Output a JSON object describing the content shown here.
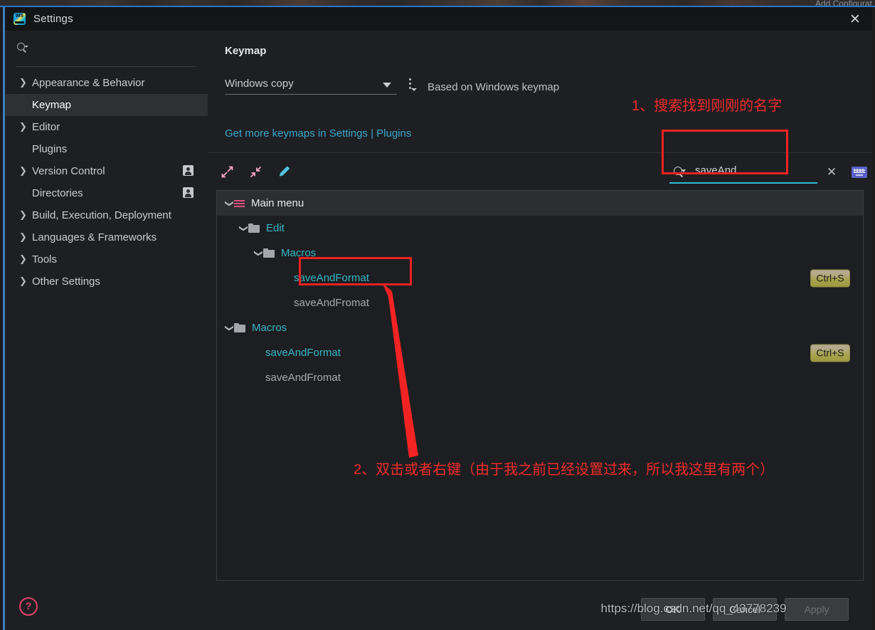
{
  "background": {
    "add_configuration_label": "Add Configurat"
  },
  "window": {
    "title": "Settings",
    "app_icon": "webstorm-icon",
    "close_icon": "close-icon"
  },
  "sidebar": {
    "search": {
      "placeholder": "",
      "value": "",
      "icon": "search-icon"
    },
    "items": [
      {
        "label": "Appearance & Behavior",
        "expandable": true,
        "selected": false,
        "badge": false
      },
      {
        "label": "Keymap",
        "expandable": false,
        "selected": true,
        "badge": false
      },
      {
        "label": "Editor",
        "expandable": true,
        "selected": false,
        "badge": false
      },
      {
        "label": "Plugins",
        "expandable": false,
        "selected": false,
        "badge": false
      },
      {
        "label": "Version Control",
        "expandable": true,
        "selected": false,
        "badge": true
      },
      {
        "label": "Directories",
        "expandable": false,
        "selected": false,
        "badge": true
      },
      {
        "label": "Build, Execution, Deployment",
        "expandable": true,
        "selected": false,
        "badge": false
      },
      {
        "label": "Languages & Frameworks",
        "expandable": true,
        "selected": false,
        "badge": false
      },
      {
        "label": "Tools",
        "expandable": true,
        "selected": false,
        "badge": false
      },
      {
        "label": "Other Settings",
        "expandable": true,
        "selected": false,
        "badge": false
      }
    ]
  },
  "content": {
    "pane_title": "Keymap",
    "keymap_select": {
      "value": "Windows copy"
    },
    "kebab_menu": "more-options-icon",
    "based_on": "Based on Windows keymap",
    "plugins_link": "Get more keymaps in Settings | Plugins",
    "toolbar": {
      "expand_all": "expand-all-icon",
      "collapse_all": "collapse-all-icon",
      "edit": "edit-pencil-icon"
    },
    "tree_search": {
      "value": "saveAnd",
      "search_icon": "search-icon",
      "clear_icon": "close-icon",
      "keyboard_icon": "keyboard-icon"
    },
    "tree": [
      {
        "label": "Main menu",
        "indent": 0,
        "kind": "menu",
        "chevron": "down",
        "color": "white",
        "shortcut": "",
        "highlighted": true
      },
      {
        "label": "Edit",
        "indent": 1,
        "kind": "folder",
        "chevron": "down",
        "color": "cyan",
        "shortcut": "",
        "highlighted": false
      },
      {
        "label": "Macros",
        "indent": 2,
        "kind": "folder",
        "chevron": "down",
        "color": "cyan",
        "shortcut": "",
        "highlighted": false
      },
      {
        "label": "saveAndFormat",
        "indent": 3,
        "kind": "action",
        "chevron": "",
        "color": "cyan",
        "shortcut": "Ctrl+S",
        "highlighted": false
      },
      {
        "label": "saveAndFromat",
        "indent": 3,
        "kind": "action",
        "chevron": "",
        "color": "gray",
        "shortcut": "",
        "highlighted": false
      },
      {
        "label": "Macros",
        "indent": 0,
        "kind": "folder",
        "chevron": "down",
        "color": "cyan",
        "shortcut": "",
        "highlighted": false
      },
      {
        "label": "saveAndFormat",
        "indent": 1,
        "kind": "action",
        "chevron": "",
        "color": "cyan",
        "shortcut": "Ctrl+S",
        "highlighted": false
      },
      {
        "label": "saveAndFromat",
        "indent": 1,
        "kind": "action",
        "chevron": "",
        "color": "gray",
        "shortcut": "",
        "highlighted": false
      }
    ]
  },
  "footer": {
    "help_icon": "help-question-icon",
    "ok_label": "OK",
    "cancel_label": "Cancel",
    "apply_label": "Apply"
  },
  "annotations": {
    "step1": "1、搜索找到刚刚的名字",
    "step2": "2、双击或者右键（由于我之前已经设置过来，所以我这里有两个）",
    "accent_color": "#ee2222"
  },
  "watermark": "https://blog.csdn.net/qq_43778239"
}
